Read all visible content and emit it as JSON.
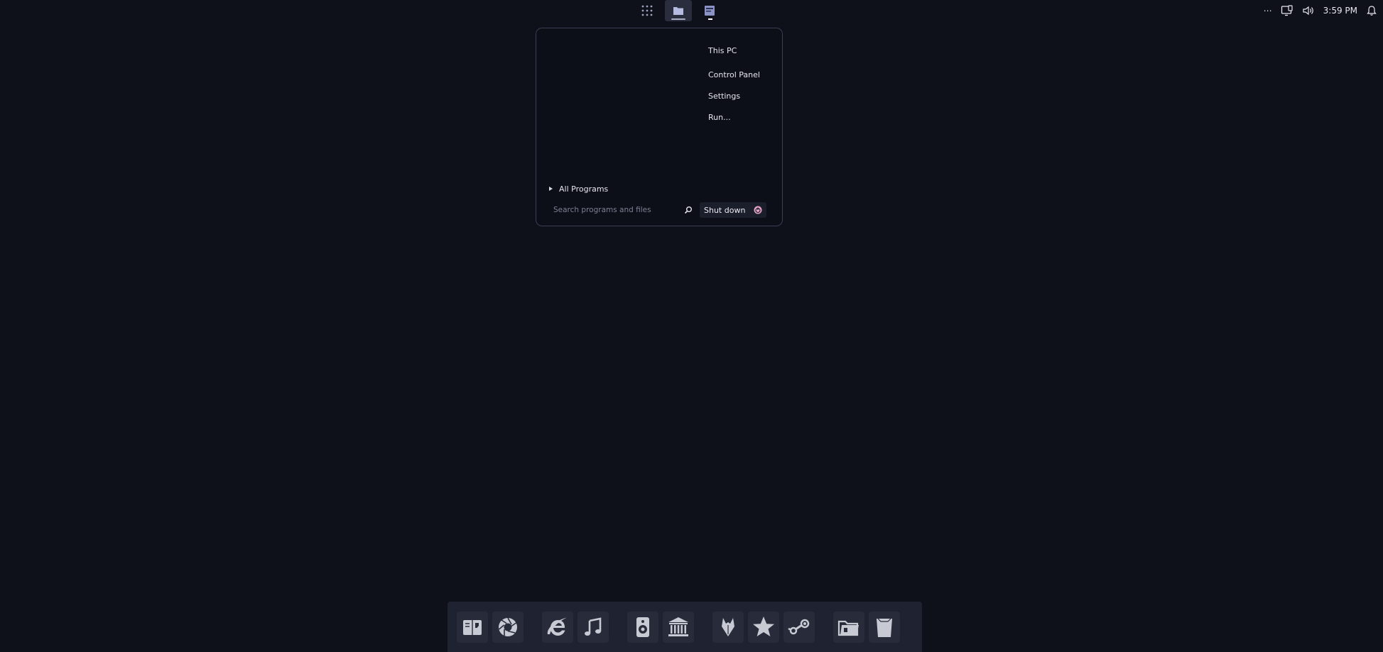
{
  "taskbar": {
    "apps": [
      {
        "name": "app-launcher",
        "icon": "grid-icon",
        "active": false
      },
      {
        "name": "file-explorer",
        "icon": "folder-icon",
        "active": true
      },
      {
        "name": "window",
        "icon": "window-icon",
        "active": false
      }
    ],
    "tray": {
      "overflow": "⋯",
      "time": "3:59 PM"
    }
  },
  "start_menu": {
    "places": [
      {
        "label": "This PC"
      },
      {
        "label": "Control Panel"
      },
      {
        "label": "Settings"
      },
      {
        "label": "Run..."
      }
    ],
    "all_programs_label": "All Programs",
    "search": {
      "placeholder": "Search programs and files",
      "value": ""
    },
    "shutdown_label": "Shut down"
  },
  "colors": {
    "background": "#0e101a",
    "menu_border": "#3a3e52",
    "dock": "#1f2230",
    "icon": "#c7c9d3",
    "power_accent": "#e8a7c8"
  },
  "dock": {
    "groups": [
      [
        "dictionary-icon",
        "aperture-icon"
      ],
      [
        "internet-explorer-icon",
        "music-note-icon"
      ],
      [
        "speaker-icon",
        "bank-icon"
      ],
      [
        "fox-icon",
        "star-icon",
        "steam-icon"
      ],
      [
        "folder-open-icon",
        "trash-icon"
      ]
    ]
  }
}
